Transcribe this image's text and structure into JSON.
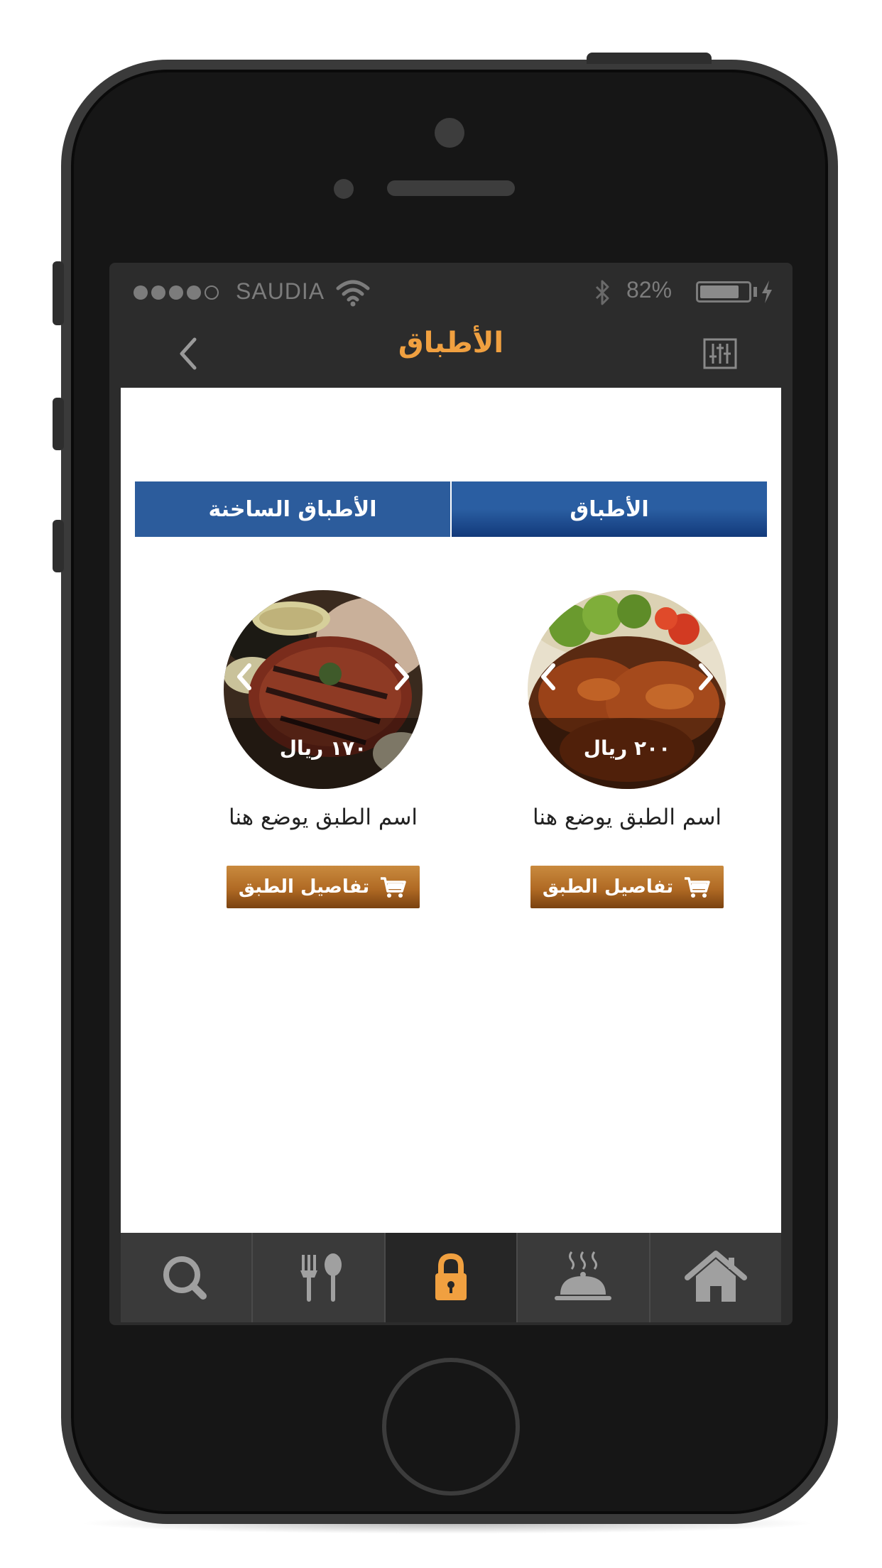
{
  "status_bar": {
    "carrier": "SAUDIA",
    "battery_percent": "82%",
    "battery_level": 0.82,
    "signal_bars": 4,
    "icons": [
      "wifi-icon",
      "bluetooth-icon",
      "battery-icon",
      "charging-icon"
    ]
  },
  "nav": {
    "title": "الأطباق",
    "back_icon": "chevron-left-icon",
    "filter_icon": "sliders-icon"
  },
  "tabs": [
    {
      "label": "الأطباق الساخنة",
      "selected": false
    },
    {
      "label": "الأطباق",
      "selected": true
    }
  ],
  "dishes": [
    {
      "image": "grilled-steak-photo",
      "price": "١٧٠ ريال",
      "name": "اسم الطبق يوضع هنا",
      "button_label": "تفاصيل الطبق",
      "button_icon": "cart-icon"
    },
    {
      "image": "roasted-chicken-photo",
      "price": "٢٠٠ ريال",
      "name": "اسم الطبق يوضع هنا",
      "button_label": "تفاصيل الطبق",
      "button_icon": "cart-icon"
    }
  ],
  "tabbar": {
    "items": [
      {
        "icon": "search-icon",
        "active": false
      },
      {
        "icon": "fork-spoon-icon",
        "active": false
      },
      {
        "icon": "lock-icon",
        "active": true
      },
      {
        "icon": "serving-dish-icon",
        "active": false
      },
      {
        "icon": "home-icon",
        "active": false
      }
    ]
  },
  "colors": {
    "accent_orange": "#f0a040",
    "tab_blue": "#2c5c9c",
    "tab_blue_dark": "#12397a",
    "button_brown": "#b06a24",
    "phone_body": "#161616",
    "screen_bar": "#2c2c2c",
    "tabbar_bg": "#3a3a3a",
    "tabbar_active_bg": "#262626",
    "icon_gray": "#a0a0a0"
  }
}
